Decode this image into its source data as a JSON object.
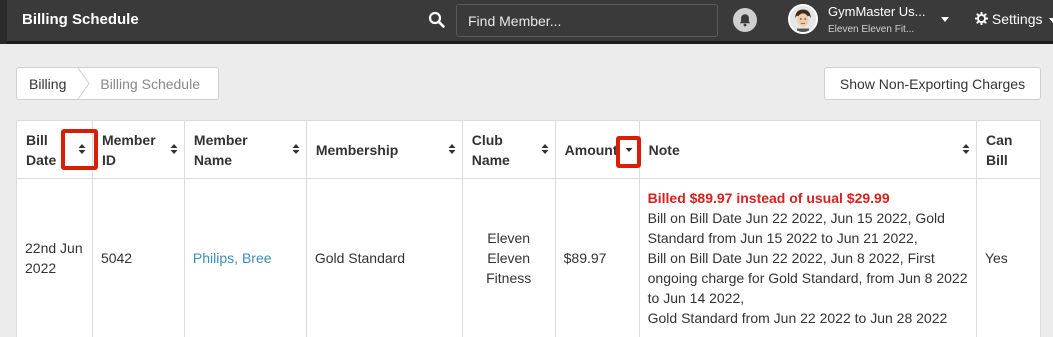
{
  "header": {
    "app_title": "Billing Schedule",
    "search_placeholder": "Find Member...",
    "user_name": "GymMaster Us...",
    "user_club": "Eleven Eleven Fit...",
    "settings_label": "Settings"
  },
  "breadcrumb": {
    "items": [
      "Billing",
      "Billing Schedule"
    ]
  },
  "actions": {
    "non_exporting_label": "Show Non-Exporting Charges"
  },
  "table": {
    "columns": [
      {
        "line1": "Bill",
        "line2": "Date"
      },
      {
        "line1": "Member",
        "line2": "ID"
      },
      {
        "line1": "Member",
        "line2": "Name"
      },
      {
        "line1": "Membership",
        "line2": ""
      },
      {
        "line1": "Club",
        "line2": "Name"
      },
      {
        "line1": "Amount",
        "line2": ""
      },
      {
        "line1": "Note",
        "line2": ""
      },
      {
        "line1": "Can",
        "line2": "Bill"
      }
    ],
    "rows": [
      {
        "bill_date_line1": "22nd Jun",
        "bill_date_line2": "2022",
        "member_id": "5042",
        "member_name": "Philips, Bree",
        "membership": "Gold Standard",
        "club_line1": "Eleven",
        "club_line2": "Eleven",
        "club_line3": "Fitness",
        "amount": "$89.97",
        "note_highlight": "Billed $89.97 instead of usual $29.99",
        "note_lines": [
          "Bill on Bill Date Jun 22 2022, Jun 15 2022, Gold",
          "Standard from Jun 15 2022 to Jun 21 2022,",
          "Bill on Bill Date Jun 22 2022, Jun 8 2022, First",
          "ongoing charge for Gold Standard, from Jun 8 2022",
          "to Jun 14 2022,",
          "Gold Standard from Jun 22 2022 to Jun 28 2022"
        ],
        "can_bill": "Yes"
      }
    ]
  },
  "colors": {
    "topbar": "#3a3a3a",
    "link": "#3c8dbc",
    "note_red": "#d9201e",
    "highlight_box": "#d81e05"
  },
  "icons": [
    "search-icon",
    "bell-icon",
    "avatar",
    "gear-icon",
    "chevron-down-icon",
    "sort-icon",
    "sort-desc-icon"
  ]
}
